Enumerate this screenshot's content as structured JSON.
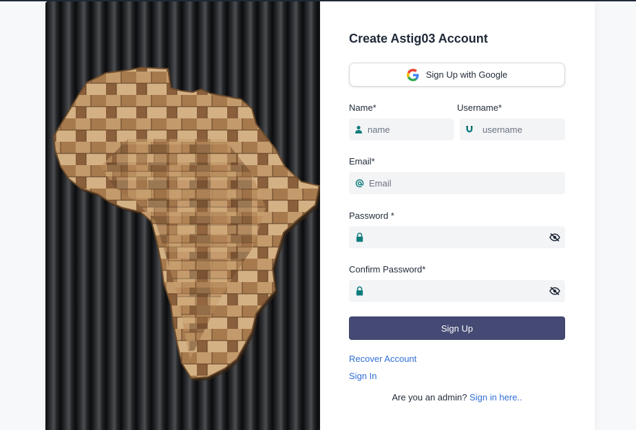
{
  "form": {
    "title": "Create Astig03 Account",
    "google_button": "Sign Up with Google",
    "name": {
      "label": "Name*",
      "placeholder": "name"
    },
    "username": {
      "label": "Username*",
      "placeholder": "username"
    },
    "email": {
      "label": "Email*",
      "placeholder": "Email"
    },
    "password": {
      "label": "Password *",
      "placeholder": ""
    },
    "confirm_password": {
      "label": "Confirm Password*",
      "placeholder": ""
    },
    "submit_button": "Sign Up",
    "recover_link": "Recover Account",
    "signin_link": "Sign In",
    "admin_prompt": "Are you an admin?",
    "admin_link": "Sign in here.."
  },
  "icons": {
    "google": "google-logo-icon",
    "name": "user-icon",
    "username": "magnet-icon",
    "email": "at-sign-icon",
    "password": "lock-icon",
    "toggle": "eye-off-icon"
  },
  "colors": {
    "accent": "#444a73",
    "link": "#2f6fd6",
    "icon_teal": "#0f7c7c",
    "field_bg": "#f3f4f6"
  }
}
